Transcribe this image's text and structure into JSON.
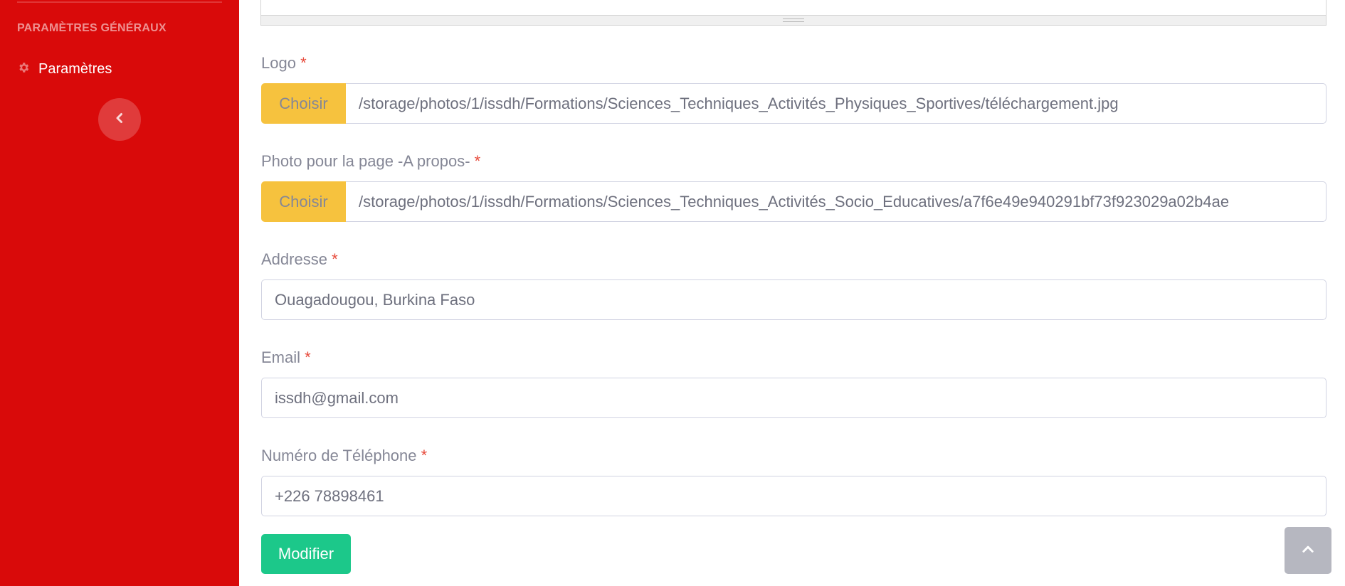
{
  "sidebar": {
    "heading": "PARAMÈTRES GÉNÉRAUX",
    "items": [
      {
        "label": "Paramètres",
        "icon": "gear-icon"
      }
    ],
    "toggle_icon": "chevron-left-icon",
    "color": "#d90a0a"
  },
  "form": {
    "required_mark": "*",
    "logo": {
      "label": "Logo",
      "button": "Choisir",
      "value": "/storage/photos/1/issdh/Formations/Sciences_Techniques_Activités_Physiques_Sportives/téléchargement.jpg"
    },
    "about_photo": {
      "label": "Photo pour la page -A propos-",
      "button": "Choisir",
      "value": "/storage/photos/1/issdh/Formations/Sciences_Techniques_Activités_Socio_Educatives/a7f6e49e940291bf73f923029a02b4ae"
    },
    "address": {
      "label": "Addresse",
      "value": "Ouagadougou, Burkina Faso"
    },
    "email": {
      "label": "Email",
      "value": "issdh@gmail.com"
    },
    "phone": {
      "label": "Numéro de Téléphone",
      "value": "+226 78898461"
    },
    "submit": "Modifier"
  },
  "scroll_top_icon": "chevron-up-icon",
  "colors": {
    "choose_button": "#f6c23e",
    "submit_button": "#1cc88a",
    "required": "#e74a3b"
  }
}
